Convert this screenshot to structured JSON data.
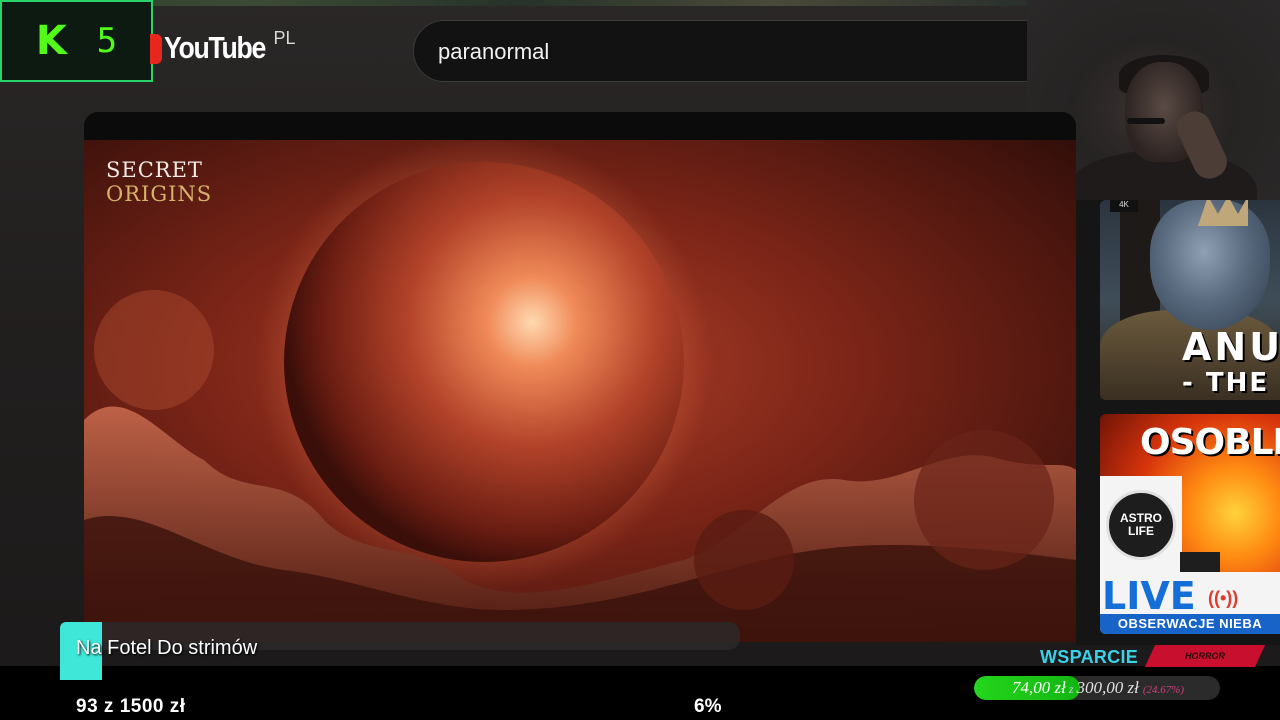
{
  "kick": {
    "logo": "K",
    "count": "5"
  },
  "youtube": {
    "wordmark": "YouTube",
    "region": "PL"
  },
  "search": {
    "query": "paranormal"
  },
  "video": {
    "channel_watermark_line1": "SECRET",
    "channel_watermark_line2": "ORIGINS"
  },
  "sidebar": {
    "thumb1": {
      "badge": "4K",
      "title": "ANU",
      "subtitle": "- THE"
    },
    "thumb2": {
      "title": "OSOBLIW",
      "logo_line1": "ASTRO",
      "logo_line2": "LIFE",
      "live": "LIVE",
      "banner": "OBSERWACJE NIEBA"
    }
  },
  "goal": {
    "title": "Na Fotel Do strimów",
    "amount": "93  z  1500  zł",
    "percent": "6%",
    "progress_fraction": 0.062
  },
  "support": {
    "label": "WSPARCIE",
    "tag": "HORROR",
    "current": "74,00 zł",
    "separator": "z",
    "goal": "300,00 zł",
    "percent": "(24.67%)",
    "progress_fraction": 0.2467
  },
  "colors": {
    "kick_green": "#53fc18",
    "youtube_red": "#e6271d",
    "goal_accent": "#3ee7d8",
    "support_cyan": "#38d3e8",
    "donate_green": "#25d61b"
  }
}
